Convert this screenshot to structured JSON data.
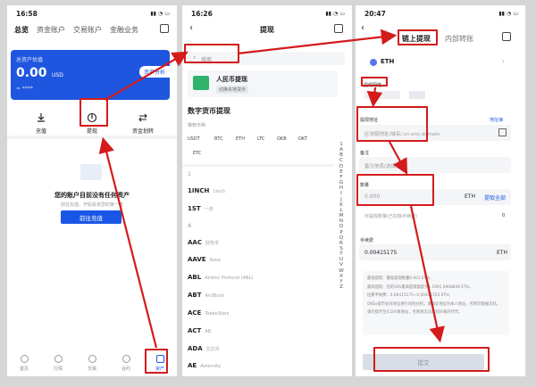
{
  "p1": {
    "time": "16:58",
    "tabs": [
      "总览",
      "资金账户",
      "交易账户",
      "金融业务"
    ],
    "card": {
      "label": "总资产估值",
      "amount": "0.00",
      "unit": "USD",
      "analysis": "资产分析"
    },
    "actions": [
      "充值",
      "提现",
      "资金划转"
    ],
    "empty": {
      "title": "您的账户目前没有任何资产",
      "sub": "前往充值，开始投资您的第一笔",
      "button": "前往充值"
    },
    "bottom_tabs": [
      "首页",
      "行情",
      "交易",
      "合约",
      "资产"
    ]
  },
  "p2": {
    "time": "16:26",
    "title": "提现",
    "search_placeholder": "搜索",
    "rmb": {
      "title": "人民币提现",
      "sub": "切换本地货币"
    },
    "digital_title": "数字货币提现",
    "hot_label": "推荐币种",
    "chips": [
      "USDT",
      "BTC",
      "ETH",
      "LTC",
      "OKB",
      "OKT",
      "ETC"
    ],
    "section_letter_1": "1",
    "section_letter_a": "A",
    "coins": [
      {
        "sym": "1INCH",
        "name": "1inch"
      },
      {
        "sym": "1ST",
        "name": "一流"
      },
      {
        "sym": "AAC",
        "name": "财务币"
      },
      {
        "sym": "AAVE",
        "name": "Aave"
      },
      {
        "sym": "ABL",
        "name": "Airbloc Protocol (ABL)"
      },
      {
        "sym": "ABT",
        "name": "ArcBlock"
      },
      {
        "sym": "ACE",
        "name": "TokenStars"
      },
      {
        "sym": "ACT",
        "name": "AB"
      },
      {
        "sym": "ADA",
        "name": "艾达币"
      },
      {
        "sym": "AE",
        "name": "Aeternity"
      }
    ],
    "index": [
      "1",
      "A",
      "B",
      "C",
      "D",
      "E",
      "F",
      "G",
      "H",
      "I",
      "J",
      "K",
      "L",
      "M",
      "N",
      "O",
      "P",
      "Q",
      "R",
      "S",
      "T",
      "U",
      "V",
      "W",
      "X",
      "Y",
      "Z"
    ]
  },
  "p3": {
    "time": "20:47",
    "tab_active": "链上提现",
    "tab_other": "内部转账",
    "coin": "ETH",
    "network_label": "提现网络",
    "address_label": "提现地址",
    "address_book": "地址簿",
    "address_placeholder": "区块链地址/域名/.cn.ens.domain",
    "remark_label": "备注",
    "remark_placeholder": "备注信息(选填)",
    "amount_label": "数量",
    "amount_placeholder": "0.000",
    "amount_unit": "ETH",
    "withdraw_all": "提取全部",
    "fee_placeholder": "可提现数量(已扣除手续费)",
    "fee_value": "0",
    "fee_label": "手续费",
    "fee_amount": "0.00415175",
    "fee_unit": "ETH",
    "notes": [
      "最低提现：最低提现数量0.001 ETH。",
      "最高提现：您的24h最高提现额度为1.1991 6908849 ETH。",
      "估算手续费：0.00415175~0.00415743 ETH。",
      "OKEx提币会对地址进行风险分析，请保证地址为本人地址，否则可能被冻结。",
      "请勿提币至ICO众筹地址，否则将无法收到众筹的代币。"
    ],
    "submit": "提交"
  }
}
